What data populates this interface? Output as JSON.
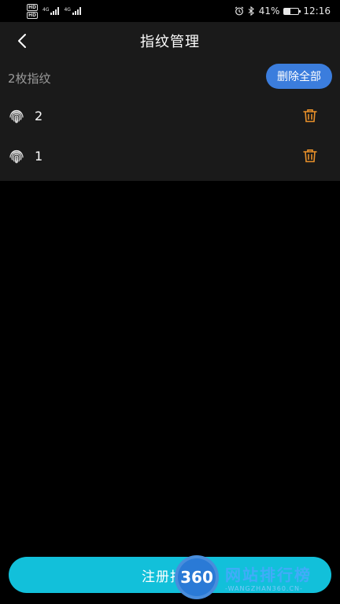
{
  "status_bar": {
    "hd1": "HD",
    "hd2": "HD",
    "net1": "4G",
    "net2": "4G",
    "battery_percent_text": "41%",
    "battery_level": 0.41,
    "time": "12:16",
    "icons": [
      "alarm-icon",
      "bluetooth-icon",
      "battery-icon"
    ]
  },
  "header": {
    "title": "指纹管理",
    "back_icon": "chevron-left-icon"
  },
  "summary": {
    "count_text": "2枚指纹",
    "delete_all_label": "删除全部"
  },
  "fingerprints": [
    {
      "name": "2"
    },
    {
      "name": "1"
    }
  ],
  "colors": {
    "accent_button": "#3b7ddd",
    "trash_icon": "#e8902a",
    "register_button": "#12c0da"
  },
  "register_button": {
    "label": "注册指纹"
  },
  "watermark": {
    "badge": "360",
    "cn": "网站排行榜",
    "en": "-WANGZHAN360.CN-"
  }
}
